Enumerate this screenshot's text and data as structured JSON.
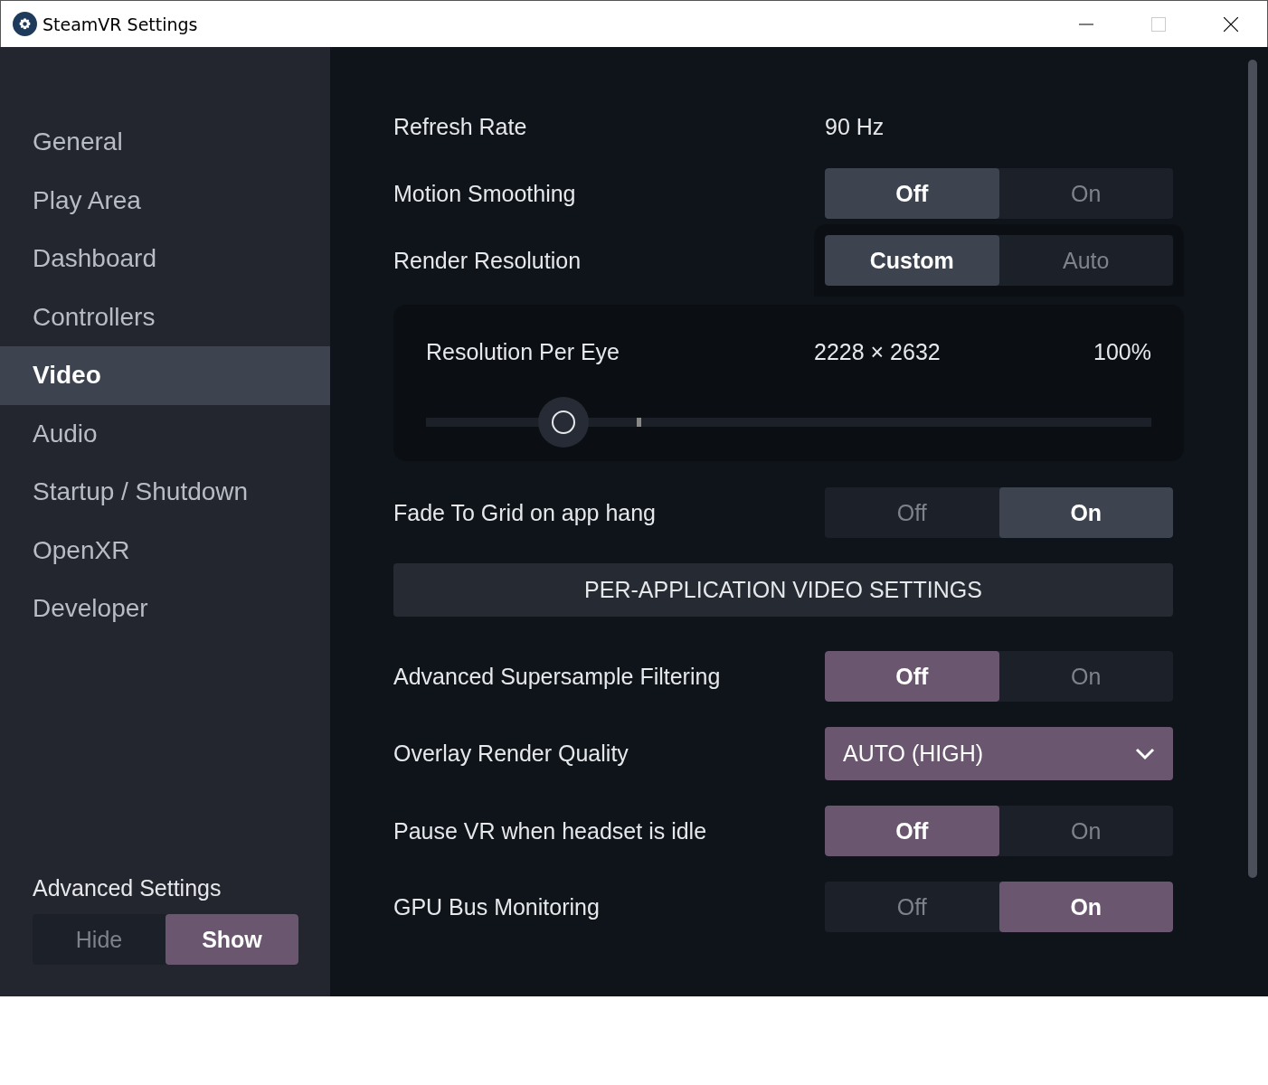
{
  "window": {
    "title": "SteamVR Settings"
  },
  "sidebar": {
    "items": [
      {
        "label": "General",
        "selected": false
      },
      {
        "label": "Play Area",
        "selected": false
      },
      {
        "label": "Dashboard",
        "selected": false
      },
      {
        "label": "Controllers",
        "selected": false
      },
      {
        "label": "Video",
        "selected": true
      },
      {
        "label": "Audio",
        "selected": false
      },
      {
        "label": "Startup / Shutdown",
        "selected": false
      },
      {
        "label": "OpenXR",
        "selected": false
      },
      {
        "label": "Developer",
        "selected": false
      }
    ],
    "advanced": {
      "label": "Advanced Settings",
      "options": [
        {
          "label": "Hide",
          "selected": false
        },
        {
          "label": "Show",
          "selected": true
        }
      ]
    }
  },
  "settings": [
    {
      "kind": "value",
      "label": "Refresh Rate",
      "value": "90 Hz"
    },
    {
      "kind": "toggle",
      "label": "Motion Smoothing",
      "advanced": false,
      "options": [
        {
          "label": "Off",
          "selected": true
        },
        {
          "label": "On",
          "selected": false
        }
      ]
    },
    {
      "kind": "toggle",
      "label": "Render Resolution",
      "advanced": false,
      "options": [
        {
          "label": "Custom",
          "selected": true
        },
        {
          "label": "Auto",
          "selected": false
        }
      ],
      "panel": {
        "label": "Resolution Per Eye",
        "resolution": "2228 × 2632",
        "percent": "100%",
        "level": 0.19
      }
    },
    {
      "kind": "toggle",
      "label": "Fade To Grid on app hang",
      "advanced": false,
      "options": [
        {
          "label": "Off",
          "selected": false
        },
        {
          "label": "On",
          "selected": true
        }
      ]
    },
    {
      "kind": "button",
      "label": "PER-APPLICATION VIDEO SETTINGS"
    },
    {
      "kind": "toggle",
      "label": "Advanced Supersample Filtering",
      "advanced": true,
      "options": [
        {
          "label": "Off",
          "selected": true
        },
        {
          "label": "On",
          "selected": false
        }
      ]
    },
    {
      "kind": "dropdown",
      "label": "Overlay Render Quality",
      "advanced": true,
      "value": "AUTO (HIGH)"
    },
    {
      "kind": "toggle",
      "label": "Pause VR when headset is idle",
      "advanced": true,
      "options": [
        {
          "label": "Off",
          "selected": true
        },
        {
          "label": "On",
          "selected": false
        }
      ]
    },
    {
      "kind": "toggle",
      "label": "GPU Bus Monitoring",
      "advanced": true,
      "options": [
        {
          "label": "Off",
          "selected": false
        },
        {
          "label": "On",
          "selected": true
        }
      ]
    }
  ]
}
